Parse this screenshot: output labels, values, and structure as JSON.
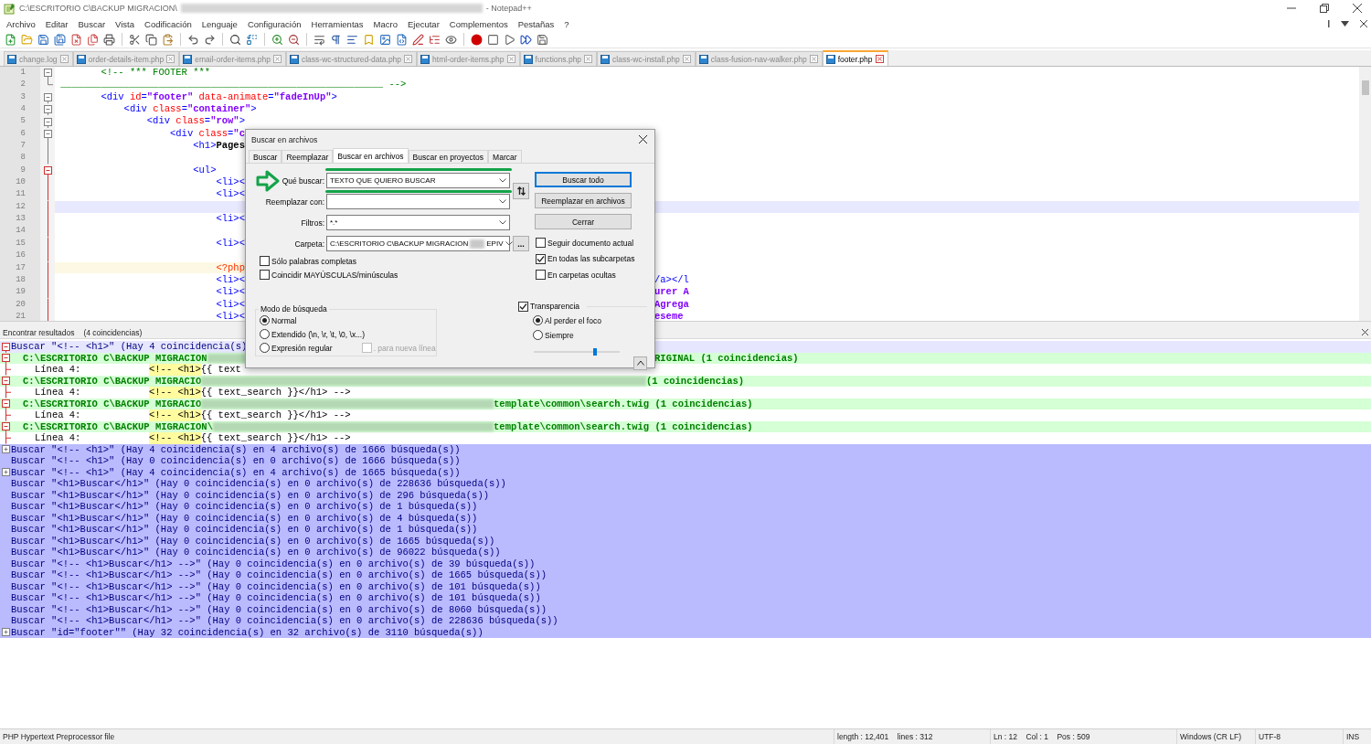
{
  "window": {
    "title": "C:\\ESCRITORIO C\\BACKUP MIGRACION\\",
    "redacted": true,
    "app": "- Notepad++"
  },
  "menu": [
    "Archivo",
    "Editar",
    "Buscar",
    "Vista",
    "Codificación",
    "Lenguaje",
    "Configuración",
    "Herramientas",
    "Macro",
    "Ejecutar",
    "Complementos",
    "Pestañas",
    "?"
  ],
  "tabs": [
    {
      "label": "change.log",
      "selected": false
    },
    {
      "label": "order-details-item.php",
      "selected": false
    },
    {
      "label": "email-order-items.php",
      "selected": false
    },
    {
      "label": "class-wc-structured-data.php",
      "selected": false
    },
    {
      "label": "html-order-items.php",
      "selected": false
    },
    {
      "label": "functions.php",
      "selected": false
    },
    {
      "label": "class-wc-install.php",
      "selected": false
    },
    {
      "label": "class-fusion-nav-walker.php",
      "selected": false
    },
    {
      "label": "footer.php",
      "selected": true
    }
  ],
  "editor": {
    "lines": [
      {
        "number": "1",
        "kind": "fold-start",
        "active": false,
        "current": false,
        "tokens": [
          {
            "text": "        <!-- *** FOOTER ***",
            "kind": "comment"
          }
        ]
      },
      {
        "number": "2",
        "kind": "fold-end",
        "active": false,
        "current": false,
        "tokens": [
          {
            "text": " ________________________________________________________ -->",
            "kind": "comment"
          }
        ]
      },
      {
        "number": "3",
        "kind": "fold-start",
        "active": false,
        "current": false,
        "tokens": [
          {
            "text": "        <div ",
            "kind": "tag"
          },
          {
            "text": "id",
            "kind": "attr"
          },
          {
            "text": "=",
            "kind": "tag"
          },
          {
            "text": "\"footer\"",
            "kind": "string"
          },
          {
            "text": " data-animate",
            "kind": "attr"
          },
          {
            "text": "=",
            "kind": "tag"
          },
          {
            "text": "\"fadeInUp\"",
            "kind": "string"
          },
          {
            "text": ">",
            "kind": "tag"
          }
        ]
      },
      {
        "number": "4",
        "kind": "fold-start",
        "active": false,
        "current": false,
        "tokens": [
          {
            "text": "            <div ",
            "kind": "tag"
          },
          {
            "text": "class",
            "kind": "attr"
          },
          {
            "text": "=",
            "kind": "tag"
          },
          {
            "text": "\"container\"",
            "kind": "string"
          },
          {
            "text": ">",
            "kind": "tag"
          }
        ]
      },
      {
        "number": "5",
        "kind": "fold-start",
        "active": false,
        "current": false,
        "tokens": [
          {
            "text": "                <div ",
            "kind": "tag"
          },
          {
            "text": "class",
            "kind": "attr"
          },
          {
            "text": "=",
            "kind": "tag"
          },
          {
            "text": "\"row\"",
            "kind": "string"
          },
          {
            "text": ">",
            "kind": "tag"
          }
        ]
      },
      {
        "number": "6",
        "kind": "fold-start",
        "active": false,
        "current": false,
        "tokens": [
          {
            "text": "                    <div ",
            "kind": "tag"
          },
          {
            "text": "class",
            "kind": "attr"
          },
          {
            "text": "=",
            "kind": "tag"
          },
          {
            "text": "\"c",
            "kind": "string"
          }
        ]
      },
      {
        "number": "7",
        "kind": "fold-line",
        "active": false,
        "current": false,
        "tokens": [
          {
            "text": "                        <h1>",
            "kind": "tag"
          },
          {
            "text": "Pages",
            "kind": "text"
          }
        ]
      },
      {
        "number": "8",
        "kind": "fold-line",
        "active": false,
        "current": false
      },
      {
        "number": "9",
        "kind": "fold-start",
        "active": true,
        "current": false,
        "tokens": [
          {
            "text": "                        <ul>",
            "kind": "tag"
          }
        ]
      },
      {
        "number": "10",
        "kind": "fold-line",
        "active": true,
        "current": false,
        "tokens": [
          {
            "text": "                            <li><",
            "kind": "tag"
          }
        ]
      },
      {
        "number": "11",
        "kind": "fold-line",
        "active": true,
        "current": false,
        "tokens": [
          {
            "text": "                            <li><",
            "kind": "tag"
          }
        ]
      },
      {
        "number": "12",
        "kind": "fold-line",
        "active": true,
        "current": true
      },
      {
        "number": "13",
        "kind": "fold-line",
        "active": true,
        "current": false,
        "tokens": [
          {
            "text": "                            <li><",
            "kind": "tag"
          }
        ]
      },
      {
        "number": "14",
        "kind": "fold-line",
        "active": true,
        "current": false
      },
      {
        "number": "15",
        "kind": "fold-line",
        "active": true,
        "current": false,
        "tokens": [
          {
            "text": "                            <li><",
            "kind": "tag"
          }
        ]
      },
      {
        "number": "16",
        "kind": "fold-line",
        "active": true,
        "current": false
      },
      {
        "number": "17",
        "kind": "fold-line",
        "active": true,
        "current": false,
        "tokens": [
          {
            "text": "                            <?php",
            "kind": "php"
          }
        ]
      },
      {
        "number": "18",
        "kind": "fold-line",
        "active": true,
        "current": false,
        "tokens": [
          {
            "text": "                            <li><",
            "kind": "tag"
          }
        ],
        "tail": [
          {
            "text": "/a></l",
            "kind": "tag"
          }
        ]
      },
      {
        "number": "19",
        "kind": "fold-line",
        "active": true,
        "current": false,
        "tokens": [
          {
            "text": "                            <li><",
            "kind": "tag"
          }
        ],
        "tail": [
          {
            "text": "urer A",
            "kind": "string"
          }
        ]
      },
      {
        "number": "20",
        "kind": "fold-line",
        "active": true,
        "current": false,
        "tokens": [
          {
            "text": "                            <li><",
            "kind": "tag"
          }
        ],
        "tail": [
          {
            "text": "Agrega",
            "kind": "string"
          }
        ]
      },
      {
        "number": "21",
        "kind": "fold-line",
        "active": true,
        "current": false,
        "tokens": [
          {
            "text": "                            <li><",
            "kind": "tag"
          }
        ],
        "tail": [
          {
            "text": "eseme",
            "kind": "string"
          }
        ]
      }
    ]
  },
  "results": {
    "title": "Encontrar resultados",
    "count": "(4 coincidencias)",
    "lines": [
      {
        "kind": "search-expanded",
        "text": "Buscar \"<!-- <h1>\" (Hay 4 coincidencia(s)"
      },
      {
        "kind": "file",
        "path": "C:\\ESCRITORIO C\\BACKUP MIGRACION",
        "tail": "RIGINAL (1 coincidencias)"
      },
      {
        "kind": "hit",
        "label": "Línea 4:",
        "match": "<!-- <h1>",
        "rest": "{{ text"
      },
      {
        "kind": "file",
        "path": "C:\\ESCRITORIO C\\BACKUP MIGRACIO",
        "tail": "(1 coincidencias)"
      },
      {
        "kind": "hit",
        "label": "Línea 4:",
        "match": "<!-- <h1>",
        "rest": "{{ text_search }}</h1> -->"
      },
      {
        "kind": "file",
        "path": "C:\\ESCRITORIO C\\BACKUP MIGRACIO",
        "tail": "template\\common\\search.twig (1 coincidencias)"
      },
      {
        "kind": "hit",
        "label": "Línea 4:",
        "match": "<!-- <h1>",
        "rest": "{{ text_search }}</h1> -->"
      },
      {
        "kind": "file",
        "path": "C:\\ESCRITORIO C\\BACKUP MIGRACION\\",
        "tail": "template\\common\\search.twig (1 coincidencias)"
      },
      {
        "kind": "hit",
        "label": "Línea 4:",
        "match": "<!-- <h1>",
        "rest": "{{ text_search }}</h1> -->"
      },
      {
        "kind": "search-collapsed",
        "text": "Buscar \"<!-- <h1>\" (Hay 4 coincidencia(s) en 4 archivo(s) de 1666 búsqueda(s))"
      },
      {
        "kind": "search",
        "text": "Buscar \"<!-- <h1>\" (Hay 0 coincidencia(s) en 0 archivo(s) de 1666 búsqueda(s))"
      },
      {
        "kind": "search-collapsed",
        "text": "Buscar \"<!-- <h1>\" (Hay 4 coincidencia(s) en 4 archivo(s) de 1665 búsqueda(s))"
      },
      {
        "kind": "search",
        "text": "Buscar \"<h1>Buscar</h1>\" (Hay 0 coincidencia(s) en 0 archivo(s) de 228636 búsqueda(s))"
      },
      {
        "kind": "search",
        "text": "Buscar \"<h1>Buscar</h1>\" (Hay 0 coincidencia(s) en 0 archivo(s) de 296 búsqueda(s))"
      },
      {
        "kind": "search",
        "text": "Buscar \"<h1>Buscar</h1>\" (Hay 0 coincidencia(s) en 0 archivo(s) de 1 búsqueda(s))"
      },
      {
        "kind": "search",
        "text": "Buscar \"<h1>Buscar</h1>\" (Hay 0 coincidencia(s) en 0 archivo(s) de 4 búsqueda(s))"
      },
      {
        "kind": "search",
        "text": "Buscar \"<h1>Buscar</h1>\" (Hay 0 coincidencia(s) en 0 archivo(s) de 1 búsqueda(s))"
      },
      {
        "kind": "search",
        "text": "Buscar \"<h1>Buscar</h1>\" (Hay 0 coincidencia(s) en 0 archivo(s) de 1665 búsqueda(s))"
      },
      {
        "kind": "search",
        "text": "Buscar \"<h1>Buscar</h1>\" (Hay 0 coincidencia(s) en 0 archivo(s) de 96022 búsqueda(s))"
      },
      {
        "kind": "search",
        "text": "Buscar \"<!-- <h1>Buscar</h1> -->\" (Hay 0 coincidencia(s) en 0 archivo(s) de 39 búsqueda(s))"
      },
      {
        "kind": "search",
        "text": "Buscar \"<!-- <h1>Buscar</h1> -->\" (Hay 0 coincidencia(s) en 0 archivo(s) de 1665 búsqueda(s))"
      },
      {
        "kind": "search",
        "text": "Buscar \"<!-- <h1>Buscar</h1> -->\" (Hay 0 coincidencia(s) en 0 archivo(s) de 101 búsqueda(s))"
      },
      {
        "kind": "search",
        "text": "Buscar \"<!-- <h1>Buscar</h1> -->\" (Hay 0 coincidencia(s) en 0 archivo(s) de 101 búsqueda(s))"
      },
      {
        "kind": "search",
        "text": "Buscar \"<!-- <h1>Buscar</h1> -->\" (Hay 0 coincidencia(s) en 0 archivo(s) de 8060 búsqueda(s))"
      },
      {
        "kind": "search",
        "text": "Buscar \"<!-- <h1>Buscar</h1> -->\" (Hay 0 coincidencia(s) en 0 archivo(s) de 228636 búsqueda(s))"
      },
      {
        "kind": "search-collapsed",
        "text": "Buscar \"id=\"footer\"\" (Hay 32 coincidencia(s) en 32 archivo(s) de 3110 búsqueda(s))"
      }
    ]
  },
  "find_dialog": {
    "title": "Buscar en archivos",
    "tabs": [
      {
        "label": "Buscar",
        "selected": false
      },
      {
        "label": "Reemplazar",
        "selected": false
      },
      {
        "label": "Buscar en archivos",
        "selected": true
      },
      {
        "label": "Buscar en proyectos",
        "selected": false
      },
      {
        "label": "Marcar",
        "selected": false
      }
    ],
    "fields": [
      {
        "label": "Qué buscar:",
        "value": "TEXTO QUE QUIERO BUSCAR"
      },
      {
        "label": "Reemplazar con:"
      },
      {
        "label": "Filtros:",
        "value": "*.*"
      },
      {
        "label": "Carpeta:",
        "value": "C:\\ESCRITORIO C\\BACKUP MIGRACION",
        "value_end": "EPIV"
      }
    ],
    "browse_button": "...",
    "buttons": [
      {
        "label": "Buscar todo",
        "default": true
      },
      {
        "label": "Reemplazar en archivos",
        "default": false
      },
      {
        "label": "Cerrar",
        "default": false
      }
    ],
    "options_left": [
      {
        "label": "Sólo palabras completas",
        "checked": false
      },
      {
        "label": "Coincidir MAYÚSCULAS/minúsculas",
        "checked": false
      }
    ],
    "options_right": [
      {
        "label": "Seguir documento actual",
        "checked": false
      },
      {
        "label": "En todas las subcarpetas",
        "checked": true
      },
      {
        "label": "En carpetas ocultas",
        "checked": false
      }
    ],
    "search_mode": {
      "title": "Modo de búsqueda",
      "options": [
        {
          "label": "Normal",
          "selected": true
        },
        {
          "label": "Extendido (\\n, \\r, \\t, \\0, \\x...)",
          "selected": false
        },
        {
          "label": "Expresión regular",
          "selected": false
        }
      ],
      "dot_newline": {
        "label": ". para nueva línea",
        "checked": false,
        "disabled": true
      }
    },
    "transparency": {
      "label": "Transparencia",
      "checked": true,
      "options": [
        {
          "label": "Al perder el foco",
          "selected": true
        },
        {
          "label": "Siempre",
          "selected": false
        }
      ],
      "level": 0.71
    }
  },
  "status_bar": [
    "PHP Hypertext Preprocessor file",
    "length : 12,401    lines : 312",
    "Ln : 12    Col : 1    Pos : 509",
    "Windows (CR LF)",
    "UTF-8",
    "INS"
  ]
}
